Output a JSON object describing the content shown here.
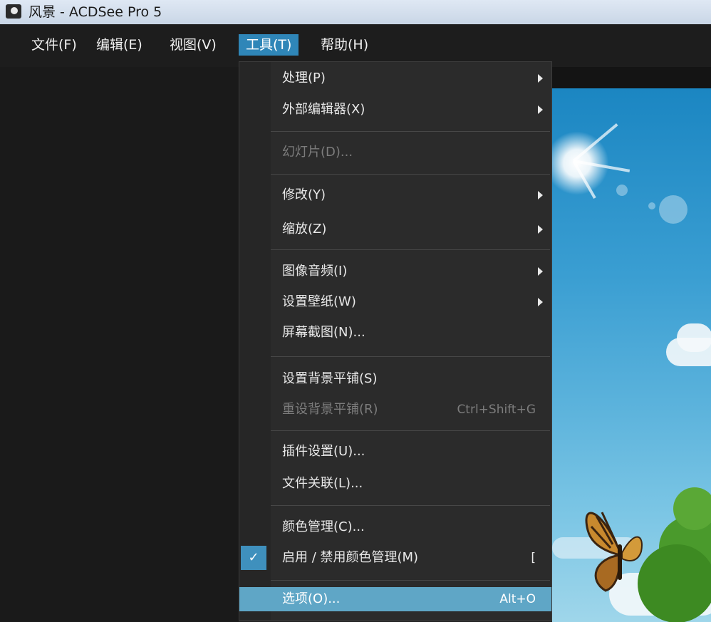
{
  "window": {
    "title": "风景 - ACDSee Pro 5"
  },
  "menubar": [
    {
      "label": "文件(F)"
    },
    {
      "label": "编辑(E)"
    },
    {
      "label": "视图(V)"
    },
    {
      "label": "工具(T)"
    },
    {
      "label": "帮助(H)"
    }
  ],
  "tools_menu": {
    "items": [
      {
        "label": "处理(P)"
      },
      {
        "label": "外部编辑器(X)"
      },
      {
        "label": "幻灯片(D)..."
      },
      {
        "label": "修改(Y)"
      },
      {
        "label": "缩放(Z)"
      },
      {
        "label": "图像音频(I)"
      },
      {
        "label": "设置壁纸(W)"
      },
      {
        "label": "屏幕截图(N)..."
      },
      {
        "label": "设置背景平铺(S)"
      },
      {
        "label": "重设背景平铺(R)",
        "shortcut": "Ctrl+Shift+G"
      },
      {
        "label": "插件设置(U)..."
      },
      {
        "label": "文件关联(L)..."
      },
      {
        "label": "颜色管理(C)..."
      },
      {
        "label": "启用 / 禁用颜色管理(M)",
        "shortcut": "[",
        "check": "✓"
      },
      {
        "label": "选项(O)...",
        "shortcut": "Alt+O"
      }
    ]
  },
  "colors": {
    "menu_highlight": "#5fa6c6",
    "menubar_active": "#2f86b8",
    "background": "#232323"
  }
}
